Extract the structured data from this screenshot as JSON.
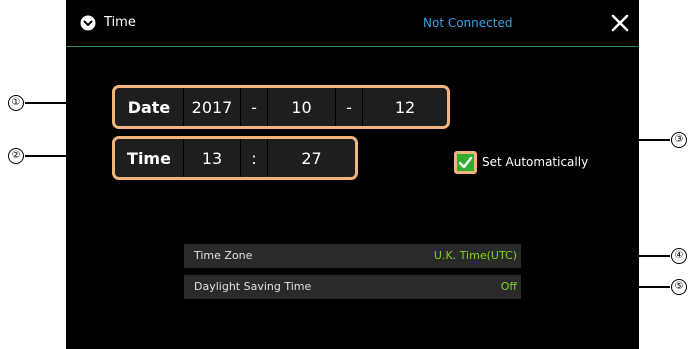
{
  "header": {
    "title": "Time",
    "status": "Not Connected",
    "clock_icon": "clock-icon",
    "close_icon": "close-icon"
  },
  "date": {
    "label": "Date",
    "year": "2017",
    "sep1": "-",
    "month": "10",
    "sep2": "-",
    "day": "12"
  },
  "time": {
    "label": "Time",
    "hour": "13",
    "sep": ":",
    "minute": "27"
  },
  "auto": {
    "label": "Set Automatically",
    "checked": true
  },
  "settings": [
    {
      "label": "Time Zone",
      "value": "U.K. Time(UTC)"
    },
    {
      "label": "Daylight Saving Time",
      "value": "Off"
    }
  ],
  "callouts": [
    "①",
    "②",
    "③",
    "④",
    "⑤"
  ],
  "colors": {
    "accent_border": "#f0b47c",
    "status_blue": "#3fa0e0",
    "value_green": "#7ed321",
    "checkbox_green": "#2fae2f"
  }
}
